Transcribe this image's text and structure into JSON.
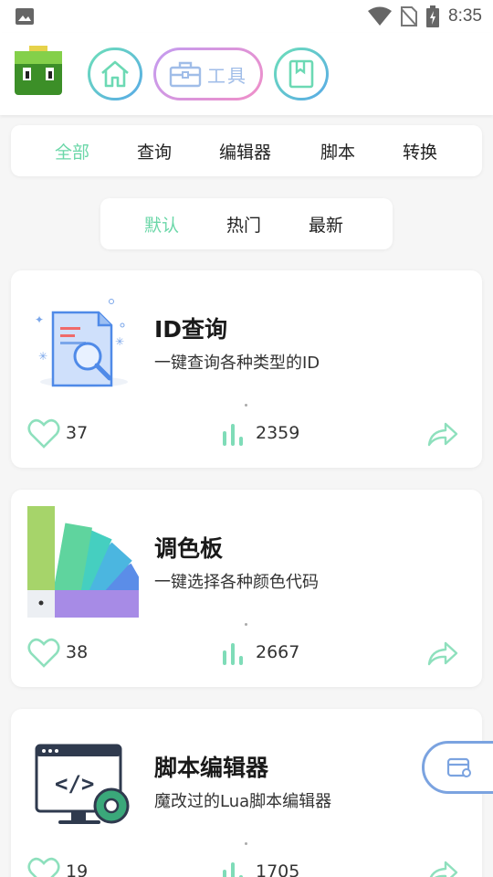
{
  "status": {
    "time": "8:35",
    "icons": [
      "image-icon",
      "wifi-icon",
      "no-sim-icon",
      "battery-charging-icon"
    ]
  },
  "header": {
    "logo": "app-logo",
    "nav": [
      {
        "name": "home",
        "icon": "home-icon"
      },
      {
        "name": "tools",
        "icon": "toolbox-icon",
        "label": "工具"
      },
      {
        "name": "book",
        "icon": "bookmark-book-icon"
      }
    ]
  },
  "category_tabs": [
    "全部",
    "查询",
    "编辑器",
    "脚本",
    "转换"
  ],
  "sort_tabs": [
    "默认",
    "热门",
    "最新"
  ],
  "cards": [
    {
      "title": "ID查询",
      "desc": "一键查询各种类型的ID",
      "likes": "37",
      "views": "2359",
      "icon": "document-search-icon"
    },
    {
      "title": "调色板",
      "desc": "一键选择各种颜色代码",
      "likes": "38",
      "views": "2667",
      "icon": "color-palette-icon"
    },
    {
      "title": "脚本编辑器",
      "desc": "魔改过的Lua脚本编辑器",
      "likes": "19",
      "views": "1705",
      "icon": "code-editor-icon"
    }
  ],
  "colors": {
    "accent": "#6bd7a8",
    "blue": "#58a9e8",
    "pink": "#f08fc8"
  }
}
